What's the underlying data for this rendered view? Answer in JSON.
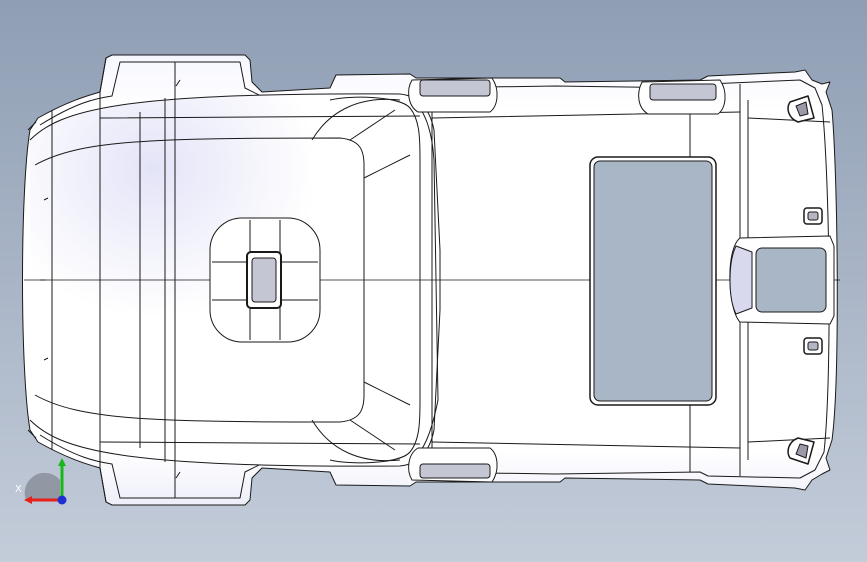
{
  "viewport": {
    "background_top": "#8f9eb4",
    "background_bottom": "#c3ccd9"
  },
  "model": {
    "part": "vehicle-roof-headliner",
    "view": "top",
    "display_mode": "shaded-with-edges"
  },
  "triad": {
    "x_label": "X",
    "x_color": "#e8201c",
    "y_color": "#18b818",
    "z_color": "#2030d0"
  }
}
